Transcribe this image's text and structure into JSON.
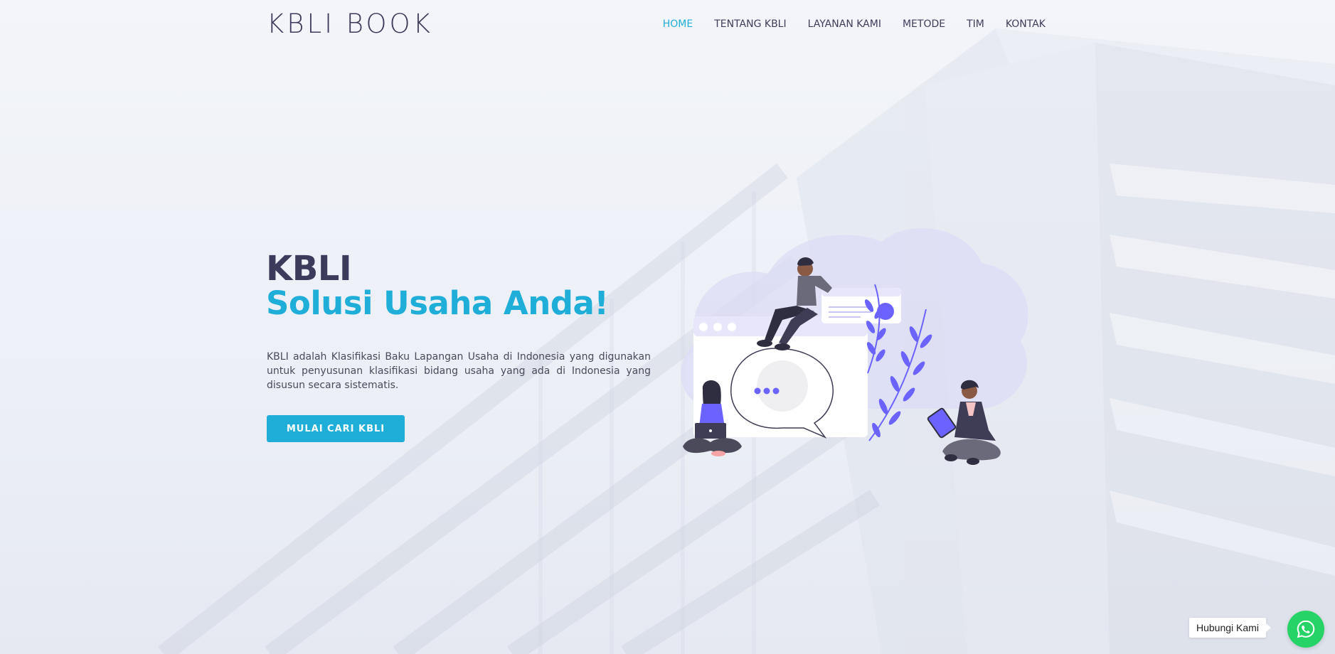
{
  "header": {
    "logo": "KBLI BOOK",
    "nav": [
      {
        "label": "HOME",
        "active": true
      },
      {
        "label": "TENTANG KBLI",
        "active": false
      },
      {
        "label": "LAYANAN KAMI",
        "active": false
      },
      {
        "label": "METODE",
        "active": false
      },
      {
        "label": "TIM",
        "active": false
      },
      {
        "label": "KONTAK",
        "active": false
      }
    ]
  },
  "hero": {
    "title": "KBLI",
    "subtitle": "Solusi Usaha Anda!",
    "description": "KBLI adalah Klasifikasi Baku Lapangan Usaha di Indonesia yang digunakan untuk penyusunan klasifikasi bidang usaha yang ada di Indonesia yang disusun secara sistematis.",
    "cta_label": "MULAI CARI KBLI"
  },
  "whatsapp": {
    "label": "Hubungi Kami",
    "icon": "whatsapp-icon"
  },
  "colors": {
    "accent": "#1eaed7",
    "heading": "#3d3b5c",
    "illustration_purple": "#6c63ff",
    "whatsapp_green": "#25d366"
  }
}
